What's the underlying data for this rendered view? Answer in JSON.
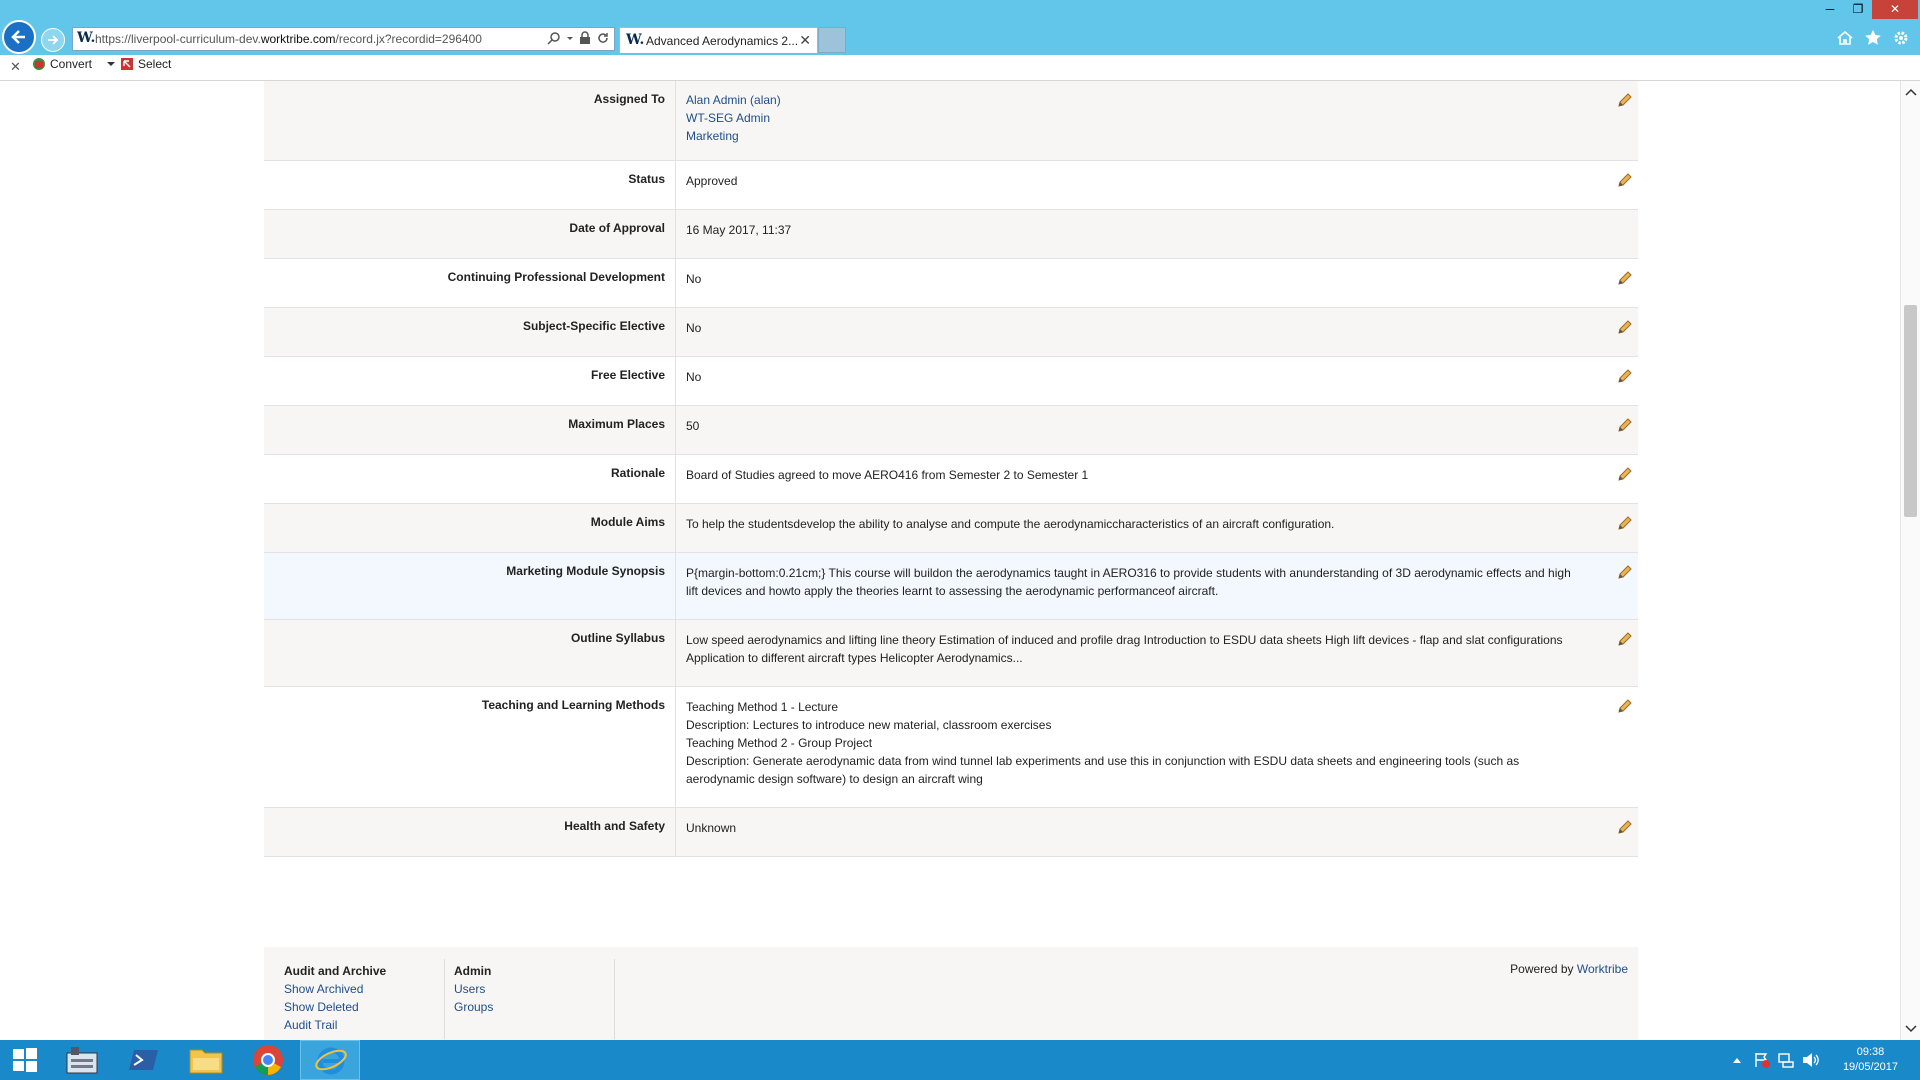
{
  "browser": {
    "url_prefix": "https://liverpool-curriculum-dev.",
    "url_domain": "worktribe.com",
    "url_suffix": "/record.jx?recordid=296400",
    "tab_title": "Advanced Aerodynamics 2...",
    "favicon_letter": "W.",
    "tab_close": "✕"
  },
  "command_bar": {
    "close": "✕",
    "convert_label": "Convert",
    "select_label": "Select"
  },
  "record": {
    "rows": [
      {
        "label": "Assigned To",
        "values": [
          "Alan Admin (alan)",
          "WT-SEG Admin",
          "Marketing"
        ],
        "links": true,
        "editable": true
      },
      {
        "label": "Status",
        "values": [
          "Approved"
        ],
        "editable": true
      },
      {
        "label": "Date of Approval",
        "values": [
          "16 May 2017, 11:37"
        ],
        "editable": false
      },
      {
        "label": "Continuing Professional Development",
        "values": [
          "No"
        ],
        "editable": true
      },
      {
        "label": "Subject-Specific Elective",
        "values": [
          "No"
        ],
        "editable": true
      },
      {
        "label": "Free Elective",
        "values": [
          "No"
        ],
        "editable": true
      },
      {
        "label": "Maximum Places",
        "values": [
          "50"
        ],
        "editable": true
      },
      {
        "label": "Rationale",
        "values": [
          "Board of Studies agreed to move AERO416 from Semester 2 to Semester 1"
        ],
        "editable": true
      },
      {
        "label": "Module Aims",
        "values": [
          "To help the studentsdevelop the ability to analyse and compute the aerodynamiccharacteristics of an aircraft configuration."
        ],
        "editable": true
      },
      {
        "label": "Marketing Module Synopsis",
        "values": [
          "P{margin-bottom:0.21cm;} This course will buildon the aerodynamics taught in AERO316 to provide students with anunderstanding of 3D aerodynamic effects and high lift devices and howto apply the theories learnt to assessing the aerodynamic performanceof aircraft."
        ],
        "editable": true
      },
      {
        "label": "Outline Syllabus",
        "values": [
          "Low speed aerodynamics and lifting line theory Estimation of induced and profile drag Introduction to ESDU data sheets High lift devices - flap and slat configurations Application to different aircraft types Helicopter Aerodynamics..."
        ],
        "editable": true
      },
      {
        "label": "Teaching and Learning Methods",
        "values": [
          "Teaching Method 1 - Lecture",
          "Description: Lectures to introduce new material, classroom exercises",
          "Teaching Method 2 - Group Project",
          "Description: Generate aerodynamic data from wind tunnel lab experiments and use this in conjunction with ESDU data sheets and engineering tools (such as aerodynamic design software) to design an aircraft wing"
        ],
        "editable": true
      },
      {
        "label": "Health and Safety",
        "values": [
          "Unknown"
        ],
        "editable": true
      }
    ]
  },
  "footer": {
    "audit_heading": "Audit and Archive",
    "audit_links": [
      "Show Archived",
      "Show Deleted",
      "Audit Trail"
    ],
    "admin_heading": "Admin",
    "admin_links": [
      "Users",
      "Groups"
    ],
    "powered_by": "Powered by",
    "powered_link": "Worktribe"
  },
  "taskbar": {
    "time": "09:38",
    "date": "19/05/2017"
  },
  "colors": {
    "chrome": "#62c6ea",
    "taskbar": "#1a89c9",
    "link": "#1f4e8c",
    "pencil": "#d9a441"
  }
}
